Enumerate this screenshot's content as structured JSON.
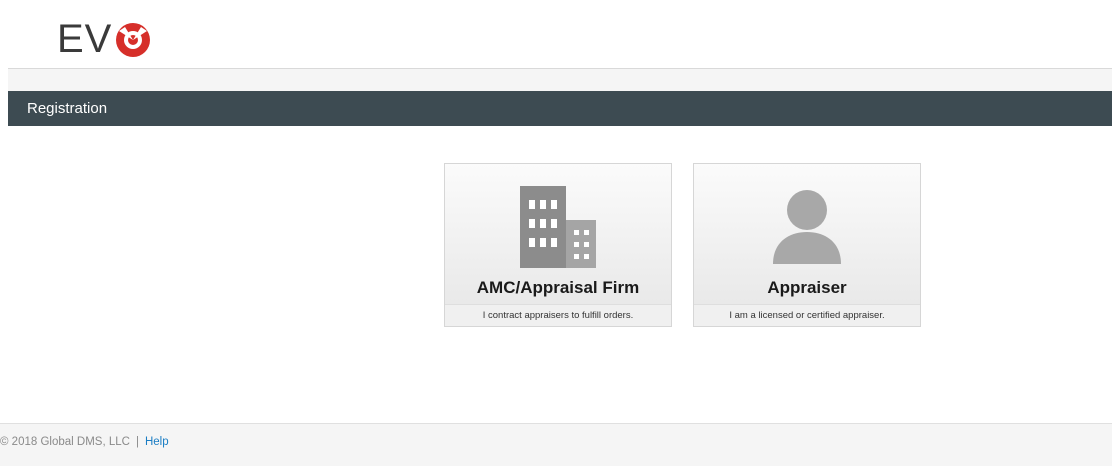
{
  "logo": {
    "text": "EV",
    "brand_color": "#d62f2a"
  },
  "titlebar": {
    "label": "Registration",
    "color": "#3d4b52"
  },
  "cards": [
    {
      "title": "AMC/Appraisal Firm",
      "description": "I contract appraisers to fulfill orders.",
      "icon": "building-icon"
    },
    {
      "title": "Appraiser",
      "description": "I am a licensed or certified appraiser.",
      "icon": "person-icon"
    }
  ],
  "footer": {
    "copyright": "© 2018 Global DMS, LLC",
    "separator": "|",
    "help_label": "Help",
    "link_color": "#1a7dc4"
  }
}
